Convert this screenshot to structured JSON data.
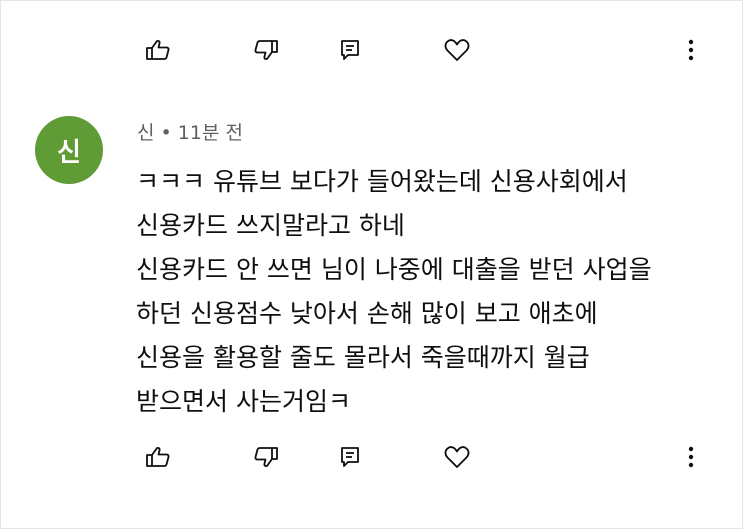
{
  "icons": {
    "like": "thumbs-up-icon",
    "dislike": "thumbs-down-icon",
    "reply": "reply-comment-icon",
    "heart": "heart-icon",
    "more": "more-vertical-icon"
  },
  "comment": {
    "avatar_letter": "신",
    "avatar_color": "#5f9c35",
    "author": "신",
    "separator": "•",
    "time": "11분 전",
    "lines": [
      "ㅋㅋㅋ 유튜브 보다가 들어왔는데 신용사회에서",
      "신용카드 쓰지말라고 하네",
      "신용카드 안 쓰면 님이 나중에 대출을 받던 사업을",
      "하던 신용점수 낮아서 손해 많이 보고 애초에",
      "신용을 활용할 줄도 몰라서 죽을때까지 월급",
      "받으면서 사는거임ㅋ"
    ]
  }
}
